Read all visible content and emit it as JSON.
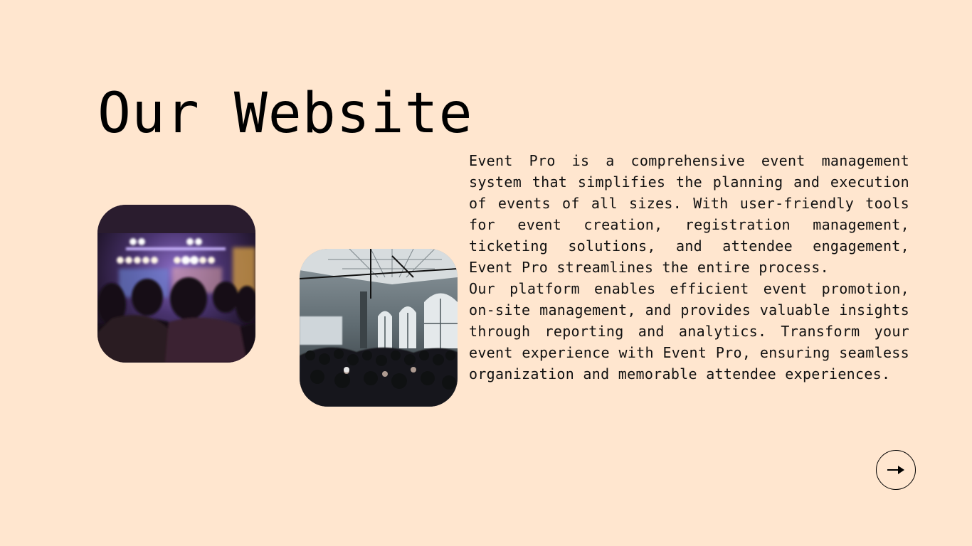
{
  "page": {
    "title": "Our Website",
    "background_color": "#ffe6cf"
  },
  "photos": [
    {
      "alt": "Concert crowd in front of a lit stage",
      "icon": "concert-photo"
    },
    {
      "alt": "Crowd of attendees in an event hall",
      "icon": "event-hall-photo"
    }
  ],
  "description": {
    "paragraphs": [
      "Event Pro is a comprehensive event management system that simplifies the planning and execution of events of all sizes. With user-friendly tools for event creation, registration management, ticketing solutions, and attendee engagement, Event Pro streamlines the entire process.",
      "Our platform enables efficient event promotion, on-site management, and provides valuable insights through reporting and analytics. Transform your event experience with Event Pro, ensuring seamless organization and memorable attendee experiences."
    ]
  },
  "navigation": {
    "next_icon": "arrow-right-icon"
  }
}
